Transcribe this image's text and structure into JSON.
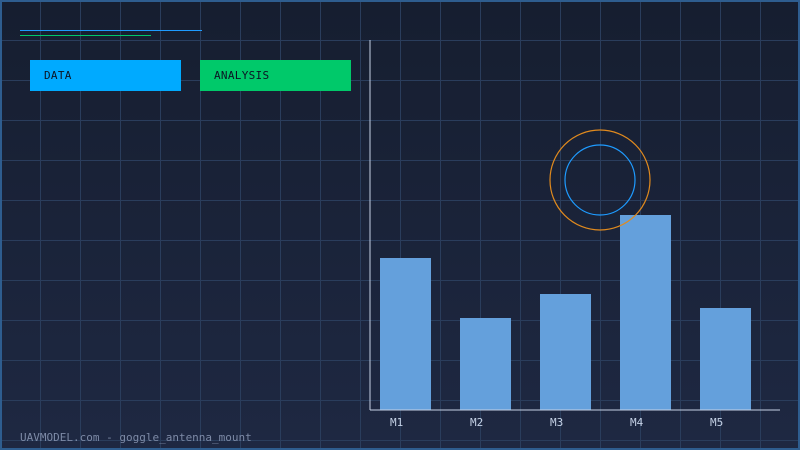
{
  "tags": {
    "data_label": "DATA",
    "analysis_label": "ANALYSIS"
  },
  "colors": {
    "data_tag": "#00aaff",
    "analysis_tag": "#00c96a",
    "bar": "#64a0dc",
    "axis": "#c6d2e6",
    "target_outer": "#e08a1e",
    "target_inner": "#1e9bff",
    "deco_line_1": "#1e9bff",
    "deco_line_2": "#00c96a"
  },
  "footer": "UAVMODEL.com - goggle_antenna_mount",
  "chart_data": {
    "type": "bar",
    "categories": [
      "M1",
      "M2",
      "M3",
      "M4",
      "M5"
    ],
    "values": [
      152,
      92,
      116,
      195,
      102
    ],
    "ylim": [
      0,
      370
    ],
    "title": "",
    "xlabel": "",
    "ylabel": "",
    "grid": true,
    "legend": "none"
  }
}
